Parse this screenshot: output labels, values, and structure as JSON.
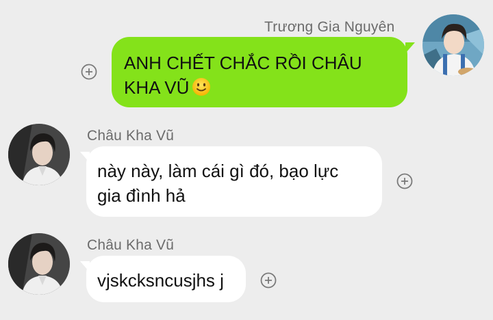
{
  "messages": [
    {
      "direction": "outgoing",
      "sender": "Trương Gia Nguyên",
      "lines": [
        "ANH CHẾT CHẮC RỒI CHÂU",
        "KHA VŨ"
      ],
      "emoji": "slightly-smiling-face",
      "bubble_color": "#84e21a"
    },
    {
      "direction": "incoming",
      "sender": "Châu Kha Vũ",
      "lines": [
        "này này, làm cái gì đó, bạo lực",
        "gia đình hả"
      ],
      "bubble_color": "#ffffff"
    },
    {
      "direction": "incoming",
      "sender": "Châu Kha Vũ",
      "lines": [
        "vjskcksncusjhs j"
      ],
      "bubble_color": "#ffffff"
    }
  ],
  "icons": {
    "add": "plus-circle-icon",
    "emoji": "slightly-smiling-face"
  },
  "colors": {
    "background": "#ededed",
    "outgoing_bubble": "#84e21a",
    "incoming_bubble": "#ffffff",
    "sender_name": "#6b6b6b"
  }
}
